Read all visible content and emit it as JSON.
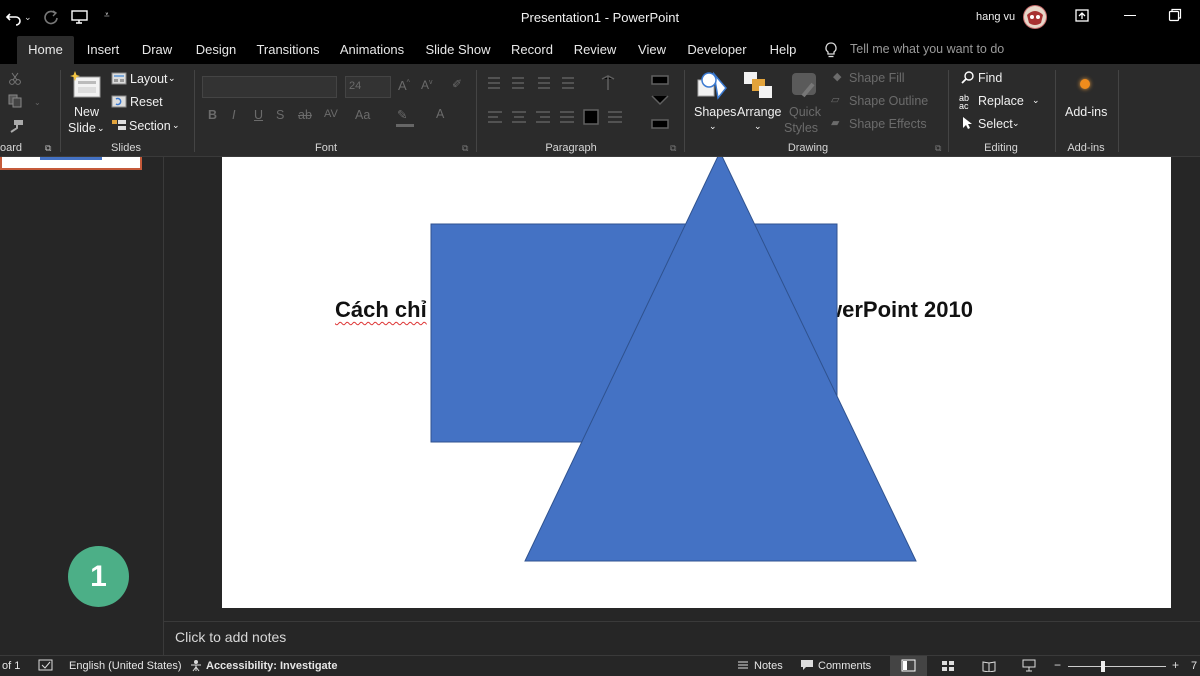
{
  "app": {
    "window_title": "Presentation1  -  PowerPoint",
    "user_name": "hang vu"
  },
  "tabs": [
    {
      "label": "Home",
      "active": true
    },
    {
      "label": "Insert"
    },
    {
      "label": "Draw"
    },
    {
      "label": "Design"
    },
    {
      "label": "Transitions"
    },
    {
      "label": "Animations"
    },
    {
      "label": "Slide Show"
    },
    {
      "label": "Record"
    },
    {
      "label": "Review"
    },
    {
      "label": "View"
    },
    {
      "label": "Developer"
    },
    {
      "label": "Help"
    }
  ],
  "tell_me": {
    "placeholder": "Tell me what you want to do"
  },
  "ribbon": {
    "clipboard": {
      "label": "oard"
    },
    "slides": {
      "label": "Slides",
      "new_slide_line1": "New",
      "new_slide_line2": "Slide",
      "layout": "Layout",
      "reset": "Reset",
      "section": "Section"
    },
    "font": {
      "label": "Font",
      "size": "24",
      "text_case": "Aa"
    },
    "paragraph": {
      "label": "Paragraph"
    },
    "drawing": {
      "label": "Drawing",
      "shapes": "Shapes",
      "arrange": "Arrange",
      "quick_styles_line1": "Quick",
      "quick_styles_line2": "Styles",
      "shape_fill": "Shape Fill",
      "shape_outline": "Shape Outline",
      "shape_effects": "Shape Effects"
    },
    "editing": {
      "label": "Editing",
      "find": "Find",
      "replace": "Replace",
      "select": "Select"
    },
    "addins": {
      "label": "Add-ins",
      "button": "Add-ins"
    }
  },
  "slide": {
    "title_left": "Cách chỉ",
    "title_right": "werPoint 2010",
    "shape_fill": "#4472c4",
    "shape_outline": "#2f528f"
  },
  "badge": {
    "number": "1",
    "color": "#4caf87"
  },
  "notes": {
    "placeholder": "Click to add notes"
  },
  "status": {
    "slide_counter": "of 1",
    "language": "English (United States)",
    "accessibility": "Accessibility: Investigate",
    "notes": "Notes",
    "comments": "Comments",
    "zoom": "7"
  }
}
